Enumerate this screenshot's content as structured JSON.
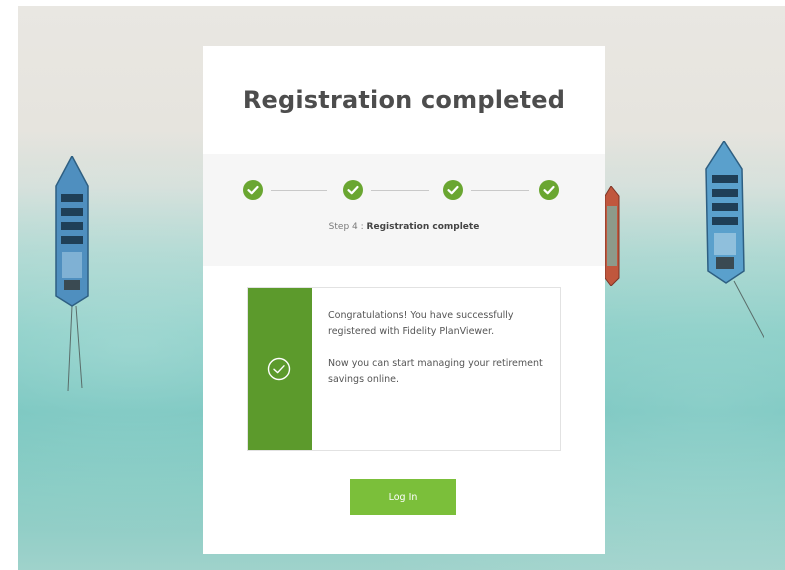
{
  "page": {
    "title": "Registration completed"
  },
  "stepper": {
    "steps": [
      {
        "status": "complete",
        "icon": "checkmark-icon"
      },
      {
        "status": "complete",
        "icon": "checkmark-icon"
      },
      {
        "status": "complete",
        "icon": "checkmark-icon"
      },
      {
        "status": "complete",
        "icon": "checkmark-icon"
      }
    ],
    "step_prefix": "Step 4 :",
    "step_name": "Registration complete"
  },
  "message": {
    "icon": "circle-check-icon",
    "line1": "Congratulations! You have successfully registered with Fidelity PlanViewer.",
    "line2": "Now you can start managing your retirement savings online."
  },
  "actions": {
    "login_label": "Log In"
  },
  "colors": {
    "accent_green": "#6aa631",
    "panel_green": "#5c9a2c",
    "button_green": "#7bbf3a"
  }
}
